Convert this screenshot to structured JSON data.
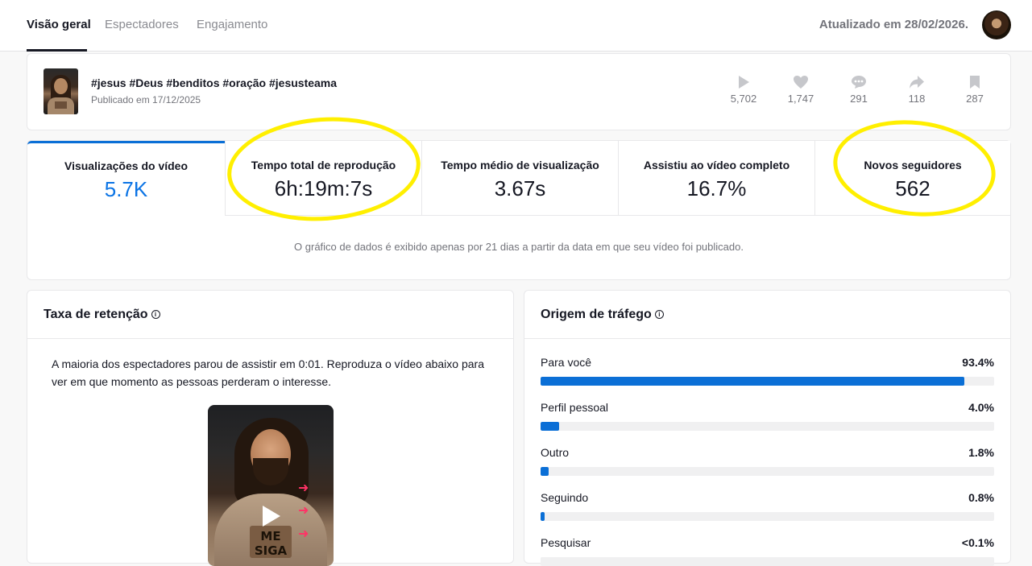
{
  "tabs": [
    {
      "label": "Visão geral",
      "active": true
    },
    {
      "label": "Espectadores",
      "active": false
    },
    {
      "label": "Engajamento",
      "active": false
    }
  ],
  "updated_text": "Atualizado em 28/02/2026.",
  "video": {
    "title": "#jesus #Deus #benditos #oração #jesusteama",
    "published": "Publicado em 17/12/2025",
    "stats": [
      {
        "icon": "play-icon",
        "value": "5,702"
      },
      {
        "icon": "heart-icon",
        "value": "1,747"
      },
      {
        "icon": "comment-icon",
        "value": "291"
      },
      {
        "icon": "share-icon",
        "value": "118"
      },
      {
        "icon": "bookmark-icon",
        "value": "287"
      }
    ]
  },
  "metrics": [
    {
      "label": "Visualizações do vídeo",
      "value": "5.7K"
    },
    {
      "label": "Tempo total de reprodução",
      "value": "6h:19m:7s"
    },
    {
      "label": "Tempo médio de visualização",
      "value": "3.67s"
    },
    {
      "label": "Assistiu ao vídeo completo",
      "value": "16.7%"
    },
    {
      "label": "Novos seguidores",
      "value": "562"
    }
  ],
  "metrics_note": "O gráfico de dados é exibido apenas por 21 dias a partir da data em que seu vídeo foi publicado.",
  "retention": {
    "title": "Taxa de retenção",
    "text": "A maioria dos espectadores parou de assistir em 0:01. Reproduza o vídeo abaixo para ver em que momento as pessoas perderam o interesse.",
    "sign_text": "ME SIGA"
  },
  "traffic": {
    "title": "Origem de tráfego",
    "sources": [
      {
        "label": "Para você",
        "value": "93.4%",
        "fraction": 0.934
      },
      {
        "label": "Perfil pessoal",
        "value": "4.0%",
        "fraction": 0.04
      },
      {
        "label": "Outro",
        "value": "1.8%",
        "fraction": 0.018
      },
      {
        "label": "Seguindo",
        "value": "0.8%",
        "fraction": 0.008
      },
      {
        "label": "Pesquisar",
        "value": "<0.1%",
        "fraction": 0.001
      }
    ]
  },
  "colors": {
    "accent": "#0b6fd6",
    "highlight": "#ffef00"
  }
}
